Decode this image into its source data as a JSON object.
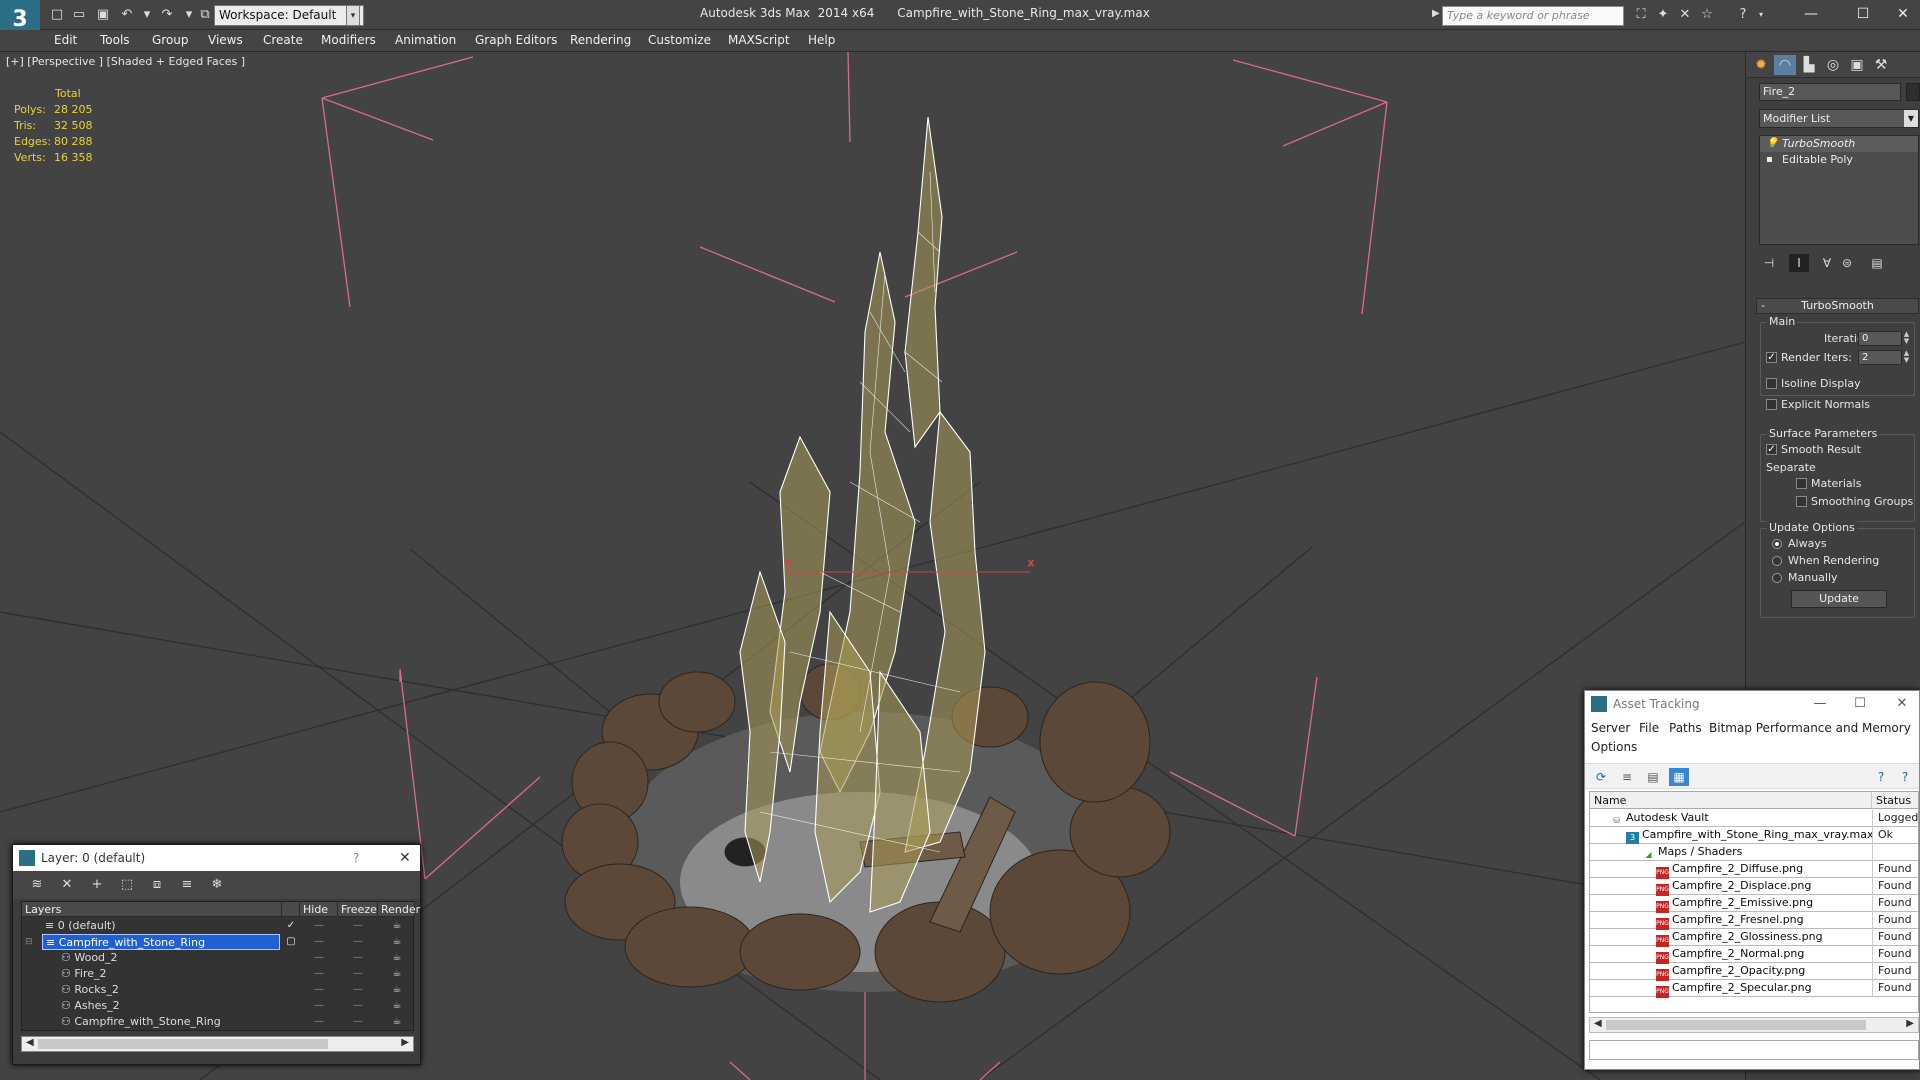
{
  "titlebar": {
    "app_name": "Autodesk 3ds Max  2014 x64",
    "file_name": "Campfire_with_Stone_Ring_max_vray.max",
    "workspace": "Workspace: Default",
    "search_placeholder": "Type a keyword or phrase"
  },
  "menu": [
    "Edit",
    "Tools",
    "Group",
    "Views",
    "Create",
    "Modifiers",
    "Animation",
    "Graph Editors",
    "Rendering",
    "Customize",
    "MAXScript",
    "Help"
  ],
  "viewport": {
    "label": "[+] [Perspective ] [Shaded + Edged Faces ]",
    "stats": {
      "header": "Total",
      "rows": [
        {
          "label": "Polys:",
          "value": "28 205"
        },
        {
          "label": "Tris:",
          "value": "32 508"
        },
        {
          "label": "Edges:",
          "value": "80 288"
        },
        {
          "label": "Verts:",
          "value": "16 358"
        }
      ]
    }
  },
  "command_panel": {
    "object_name": "Fire_2",
    "modifier_list": "Modifier List",
    "stack": [
      {
        "label": "TurboSmooth",
        "selected": true
      },
      {
        "label": "Editable Poly",
        "selected": false
      }
    ],
    "rollout_title": "TurboSmooth",
    "main_group": "Main",
    "iterations_label": "Iterations:",
    "iterations_value": "0",
    "render_iters_label": "Render Iters:",
    "render_iters_value": "2",
    "render_iters_checked": true,
    "isoline_label": "Isoline Display",
    "explicit_normals_label": "Explicit Normals",
    "surface_group": "Surface Parameters",
    "smooth_result_label": "Smooth Result",
    "separate_label": "Separate",
    "materials_label": "Materials",
    "smoothing_groups_label": "Smoothing Groups",
    "update_group": "Update Options",
    "always_label": "Always",
    "when_rendering_label": "When Rendering",
    "manually_label": "Manually",
    "update_button": "Update"
  },
  "layer_dialog": {
    "title": "Layer: 0 (default)",
    "help": "?",
    "columns": {
      "layers": "Layers",
      "hide": "Hide",
      "freeze": "Freeze",
      "render": "Render"
    },
    "rows": [
      {
        "name": "0 (default)",
        "indent": 1,
        "selected": false
      },
      {
        "name": "Campfire_with_Stone_Ring",
        "indent": 1,
        "selected": true
      },
      {
        "name": "Wood_2",
        "indent": 2,
        "selected": false
      },
      {
        "name": "Fire_2",
        "indent": 2,
        "selected": false
      },
      {
        "name": "Rocks_2",
        "indent": 2,
        "selected": false
      },
      {
        "name": "Ashes_2",
        "indent": 2,
        "selected": false
      },
      {
        "name": "Campfire_with_Stone_Ring",
        "indent": 2,
        "selected": false
      }
    ]
  },
  "asset_tracking": {
    "title": "Asset Tracking",
    "menu": [
      "Server",
      "File",
      "Paths",
      "Bitmap Performance and Memory",
      "Options"
    ],
    "columns": {
      "name": "Name",
      "status": "Status"
    },
    "rows": [
      {
        "name": "Autodesk Vault",
        "status": "Logged Out",
        "level": 0,
        "icon": "vault"
      },
      {
        "name": "Campfire_with_Stone_Ring_max_vray.max",
        "status": "Ok",
        "level": 1,
        "icon": "max"
      },
      {
        "name": "Maps / Shaders",
        "status": "",
        "level": 2,
        "icon": "maps"
      },
      {
        "name": "Campfire_2_Diffuse.png",
        "status": "Found",
        "level": 3,
        "icon": "png"
      },
      {
        "name": "Campfire_2_Displace.png",
        "status": "Found",
        "level": 3,
        "icon": "png"
      },
      {
        "name": "Campfire_2_Emissive.png",
        "status": "Found",
        "level": 3,
        "icon": "png"
      },
      {
        "name": "Campfire_2_Fresnel.png",
        "status": "Found",
        "level": 3,
        "icon": "png"
      },
      {
        "name": "Campfire_2_Glossiness.png",
        "status": "Found",
        "level": 3,
        "icon": "png"
      },
      {
        "name": "Campfire_2_Normal.png",
        "status": "Found",
        "level": 3,
        "icon": "png"
      },
      {
        "name": "Campfire_2_Opacity.png",
        "status": "Found",
        "level": 3,
        "icon": "png"
      },
      {
        "name": "Campfire_2_Specular.png",
        "status": "Found",
        "level": 3,
        "icon": "png"
      }
    ]
  },
  "colors": {
    "accent": "#2b6f86",
    "stats_text": "#e8d23a",
    "selection_bracket": "#d86a8e",
    "selected_row": "#2060d0"
  }
}
